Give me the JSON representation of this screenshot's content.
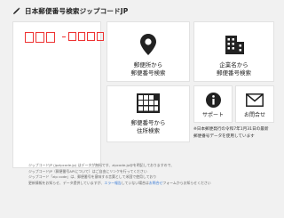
{
  "header": {
    "logo_icon": "pen-nib-icon",
    "title": "日本郵便番号検索ジップコードJP"
  },
  "postcard": {
    "zip_box_color": "#e33333"
  },
  "tiles": {
    "address_search": {
      "icon": "map-pin-icon",
      "line1": "郵便所から",
      "line2": "郵便番号検索"
    },
    "company_search": {
      "icon": "building-icon",
      "line1": "企業名から",
      "line2": "郵便番号検索"
    },
    "zip_search": {
      "icon": "zip-grid-icon",
      "line1": "郵便番号から",
      "line2": "住所検索"
    },
    "support": {
      "icon": "info-icon",
      "label": "サポート"
    },
    "contact": {
      "icon": "mail-icon",
      "label": "お問合せ"
    }
  },
  "notice": {
    "line1": "※日本郵便発行の令和7年1月31日の最新",
    "line2": "郵便番号データを使用しています"
  },
  "footer": {
    "line1": "ジップコードJP (jpzipcode.jp) はデータが無料です、zipcode.jp@を明記しておりますので、",
    "line2": "ジップコードJP（郵便番号APIについて）はご自由にリンクを行ってください",
    "line3": "ジップコード「zip code」は、郵便番号を意味する言葉として米国で使用しており",
    "line4": "更新情報をお知らせ、データ提供していますが、",
    "link": "エラー報告",
    "line5": "していない場合は",
    "link2": "お問合せ",
    "line6": "フォームからお知らせください"
  }
}
